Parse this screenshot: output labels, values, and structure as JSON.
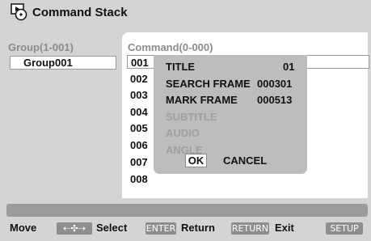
{
  "window": {
    "title": "Command Stack",
    "icon": "disc-stack-icon"
  },
  "group_panel": {
    "header": "Group(1-001)",
    "items": [
      {
        "label": "Group001",
        "selected": true
      }
    ]
  },
  "command_panel": {
    "header": "Command(0-000)",
    "rows": [
      "001",
      "002",
      "003",
      "004",
      "005",
      "006",
      "007",
      "008"
    ]
  },
  "popup": {
    "fields": [
      {
        "label": "TITLE",
        "value": "01",
        "enabled": true
      },
      {
        "label": "SEARCH FRAME",
        "value": "000301",
        "enabled": true
      },
      {
        "label": "MARK FRAME",
        "value": "000513",
        "enabled": true
      },
      {
        "label": "SUBTITLE",
        "value": "",
        "enabled": false
      },
      {
        "label": "AUDIO",
        "value": "",
        "enabled": false
      },
      {
        "label": "ANGLE",
        "value": "",
        "enabled": false
      }
    ],
    "ok_label": "OK",
    "cancel_label": "CANCEL"
  },
  "footer": {
    "move_label": "Move",
    "move_key": "⇠✣⇢",
    "select_label": "Select",
    "select_key": "ENTER",
    "return_label": "Return",
    "return_key": "RETURN",
    "exit_label": "Exit",
    "exit_key": "SETUP"
  },
  "colors": {
    "background": "#d4d4d4",
    "panel": "#ffffff",
    "popup": "#bdbdbd",
    "disabled_text": "#a0a0a0",
    "key_badge": "#8e8e8e"
  }
}
